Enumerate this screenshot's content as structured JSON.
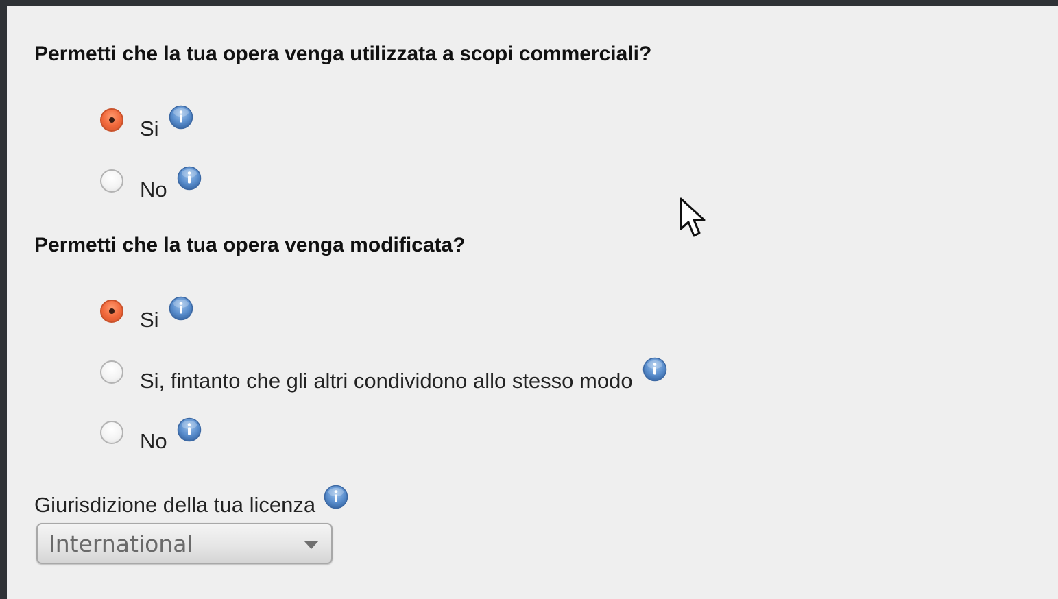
{
  "questions": {
    "commercial": {
      "title": "Permetti che la tua opera venga utilizzata a scopi commerciali?",
      "options": [
        {
          "label": "Si",
          "selected": true
        },
        {
          "label": "No",
          "selected": false
        }
      ]
    },
    "modify": {
      "title": "Permetti che la tua opera venga modificata?",
      "options": [
        {
          "label": "Si",
          "selected": true
        },
        {
          "label": "Si, fintanto che gli altri condividono allo stesso modo",
          "selected": false
        },
        {
          "label": "No",
          "selected": false
        }
      ]
    }
  },
  "jurisdiction": {
    "label": "Giurisdizione della tua licenza",
    "selected": "International"
  },
  "icons": {
    "info": "info-icon",
    "dropdown": "chevron-down-icon",
    "cursor": "mouse-pointer-icon"
  },
  "colors": {
    "radio_checked": "#f0673a",
    "info_blue": "#4f86c6",
    "panel_bg": "#efefef",
    "frame_bg": "#2f3236"
  }
}
